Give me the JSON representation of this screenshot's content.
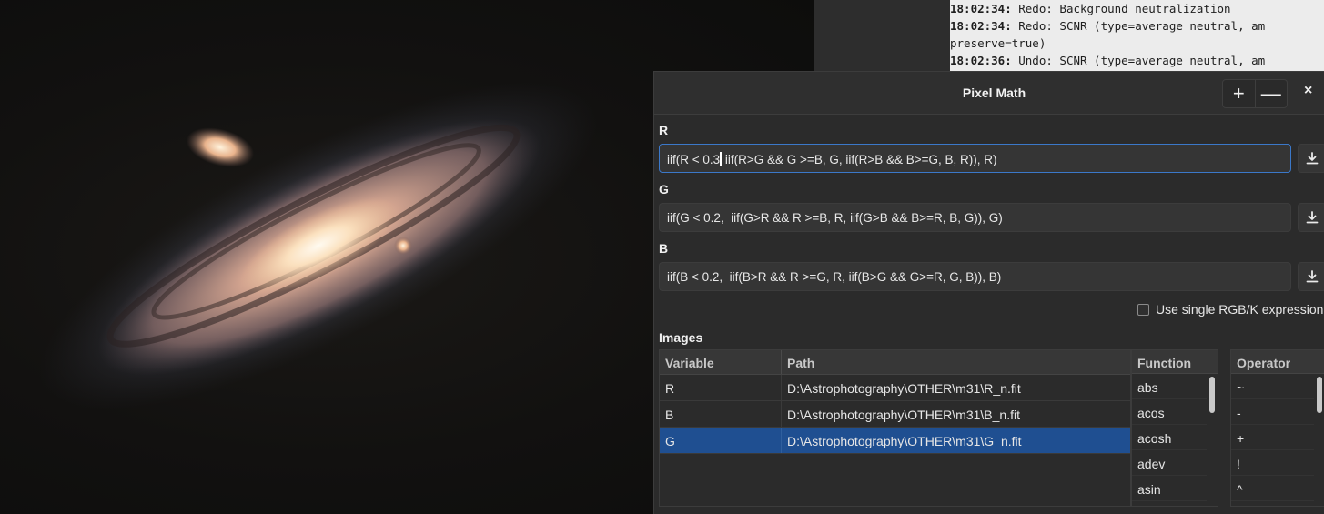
{
  "console": {
    "lines": [
      {
        "time": "18:02:34:",
        "text": " Redo: Background neutralization"
      },
      {
        "time": "18:02:34:",
        "text": " Redo: SCNR (type=average neutral, am"
      },
      {
        "time": "",
        "text": "preserve=true)"
      },
      {
        "time": "18:02:36:",
        "text": " Undo: SCNR (type=average neutral, am"
      }
    ]
  },
  "dialog": {
    "title": "Pixel Math",
    "add_label": "+",
    "remove_label": "—",
    "close_label": "×"
  },
  "channels": {
    "r": {
      "label": "R",
      "expr_before_caret": "iif(R < 0.3",
      "expr_after_caret": " iif(R>G && G >=B, G, iif(R>B && B>=G, B, R)), R)"
    },
    "g": {
      "label": "G",
      "expr": "iif(G < 0.2,  iif(G>R && R >=B, R, iif(G>B && B>=R, B, G)), G)"
    },
    "b": {
      "label": "B",
      "expr": "iif(B < 0.2,  iif(B>R && R >=G, R, iif(B>G && G>=R, G, B)), B)"
    }
  },
  "options": {
    "single_rgbk_label": "Use single RGB/K expression",
    "single_rgbk_checked": false
  },
  "images": {
    "label": "Images",
    "columns": [
      "Variable",
      "Path"
    ],
    "rows": [
      {
        "variable": "R",
        "path": "D:\\Astrophotography\\OTHER\\m31\\R_n.fit"
      },
      {
        "variable": "B",
        "path": "D:\\Astrophotography\\OTHER\\m31\\B_n.fit"
      },
      {
        "variable": "G",
        "path": "D:\\Astrophotography\\OTHER\\m31\\G_n.fit"
      }
    ],
    "selected_index": 2
  },
  "functions": {
    "header": "Function",
    "items": [
      "abs",
      "acos",
      "acosh",
      "adev",
      "asin"
    ]
  },
  "operators": {
    "header": "Operator",
    "items": [
      "~",
      "-",
      "+",
      "!",
      "^"
    ]
  },
  "icons": {
    "download": "download-icon"
  },
  "colors": {
    "selection": "#1f4f91",
    "focus_border": "#3b78c9"
  }
}
